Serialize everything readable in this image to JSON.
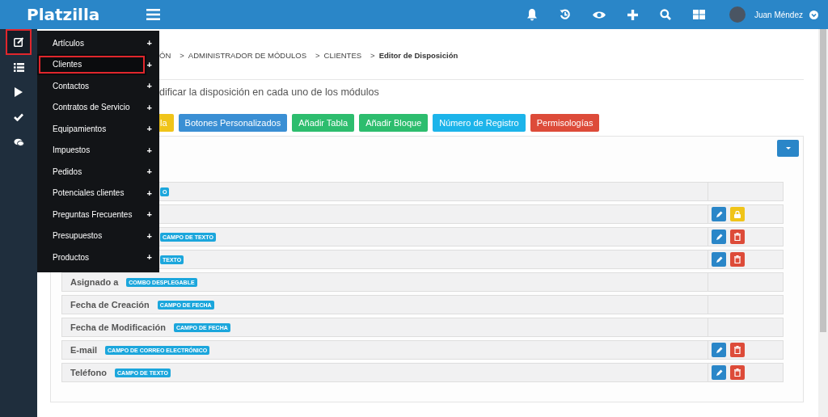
{
  "topbar": {
    "logo": "Platzilla",
    "user": "Juan Méndez"
  },
  "rail": [
    {
      "selected": true
    },
    {
      "selected": false
    },
    {
      "selected": false
    },
    {
      "selected": false
    },
    {
      "selected": false
    }
  ],
  "menu": [
    {
      "label": "Artículos",
      "selected": false,
      "expand": "+"
    },
    {
      "label": "Clientes",
      "selected": true,
      "expand": "+"
    },
    {
      "label": "Contactos",
      "selected": false,
      "expand": "+"
    },
    {
      "label": "Contratos de Servicio",
      "selected": false,
      "expand": "+"
    },
    {
      "label": "Equipamientos",
      "selected": false,
      "expand": "+"
    },
    {
      "label": "Impuestos",
      "selected": false,
      "expand": "+"
    },
    {
      "label": "Pedidos",
      "selected": false,
      "expand": "+"
    },
    {
      "label": "Potenciales clientes",
      "selected": false,
      "expand": "+"
    },
    {
      "label": "Preguntas Frecuentes",
      "selected": false,
      "expand": "+"
    },
    {
      "label": "Presupuestos",
      "selected": false,
      "expand": "+"
    },
    {
      "label": "Productos",
      "selected": false,
      "expand": "+"
    }
  ],
  "breadcrumb": [
    {
      "label": "ÓN",
      "current": false
    },
    {
      "label": "ADMINISTRADOR DE MÓDULOS",
      "current": false
    },
    {
      "label": "CLIENTES",
      "current": false
    },
    {
      "label": "Editor de Disposición",
      "current": true
    }
  ],
  "separator": ">",
  "description": "dificar la disposición en cada uno de los módulos",
  "buttons": [
    {
      "label": "la",
      "color": "#f0c419"
    },
    {
      "label": "Botones Personalizados",
      "color": "#3a8fd4"
    },
    {
      "label": "Añadir Tabla",
      "color": "#2dbd6e"
    },
    {
      "label": "Añadir Bloque",
      "color": "#2dbd6e"
    },
    {
      "label": "Número de Registro",
      "color": "#1cb4ea"
    },
    {
      "label": "Permisologías",
      "color": "#dd4b39"
    }
  ],
  "fields": [
    {
      "badge": "O"
    },
    {
      "actions": [
        {
          "kind": "edit"
        },
        {
          "kind": "lock"
        }
      ]
    },
    {
      "badge": "CAMPO DE TEXTO",
      "actions": [
        {
          "kind": "edit"
        },
        {
          "kind": "delete"
        }
      ]
    },
    {
      "badge": "TEXTO",
      "actions": [
        {
          "kind": "edit"
        },
        {
          "kind": "delete"
        }
      ]
    },
    {
      "label": "Asignado a",
      "badge": "COMBO DESPLEGABLE"
    },
    {
      "label": "Fecha de Creación",
      "badge": "CAMPO DE FECHA"
    },
    {
      "label": "Fecha de Modificación",
      "badge": "CAMPO DE FECHA"
    },
    {
      "label": "E-mail",
      "badge": "CAMPO DE CORREO ELECTRÓNICO",
      "actions": [
        {
          "kind": "edit"
        },
        {
          "kind": "delete"
        }
      ]
    },
    {
      "label": "Teléfono",
      "badge": "CAMPO DE TEXTO",
      "actions": [
        {
          "kind": "edit"
        },
        {
          "kind": "delete"
        }
      ]
    }
  ]
}
